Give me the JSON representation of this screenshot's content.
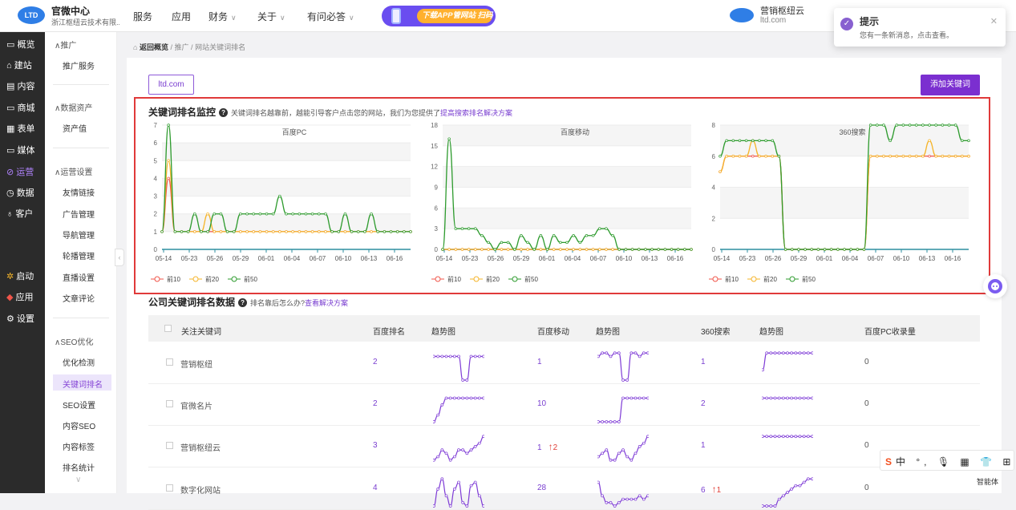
{
  "app": {
    "title": "官微中心",
    "subtitle": "浙江枢纽云技术有限...",
    "logo_text": "LTD"
  },
  "topnav": [
    {
      "label": "服务",
      "has_dropdown": false
    },
    {
      "label": "应用",
      "has_dropdown": false
    },
    {
      "label": "财务",
      "has_dropdown": true
    },
    {
      "label": "关于",
      "has_dropdown": true
    },
    {
      "label": "有问必答",
      "has_dropdown": true
    }
  ],
  "promo": {
    "text": "下载APP管网站 扫码"
  },
  "user": {
    "name": "营销枢纽云",
    "site": "ltd.com"
  },
  "toast": {
    "title": "提示",
    "message": "您有一条新消息，点击查看。"
  },
  "sidebar": [
    {
      "label": "概览",
      "icon": "dashboard-icon"
    },
    {
      "label": "建站",
      "icon": "home-icon"
    },
    {
      "label": "内容",
      "icon": "document-icon"
    },
    {
      "label": "商城",
      "icon": "cart-icon"
    },
    {
      "label": "表单",
      "icon": "form-icon"
    },
    {
      "label": "媒体",
      "icon": "media-icon"
    },
    {
      "label": "运营",
      "icon": "operation-icon",
      "active": true
    },
    {
      "label": "数据",
      "icon": "data-icon"
    },
    {
      "label": "客户",
      "icon": "user-icon"
    },
    {
      "label": "启动",
      "icon": "launch-icon"
    },
    {
      "label": "应用",
      "icon": "apps-icon"
    },
    {
      "label": "设置",
      "icon": "settings-icon"
    }
  ],
  "submenu": {
    "promote": {
      "header": "推广",
      "items": [
        "推广服务"
      ]
    },
    "assets": {
      "header": "数据资产",
      "items": [
        "资产值"
      ]
    },
    "ops": {
      "header": "运营设置",
      "items": [
        "友情链接",
        "广告管理",
        "导航管理",
        "轮播管理",
        "直播设置",
        "文章评论"
      ]
    },
    "seo": {
      "header": "SEO优化",
      "items": [
        "优化检测",
        "关键词排名",
        "SEO设置",
        "内容SEO",
        "内容标签",
        "排名统计"
      ],
      "active": "关键词排名"
    }
  },
  "breadcrumb": {
    "back": "返回概览",
    "sep": "/",
    "level1": "推广",
    "level2": "网站关键词排名"
  },
  "site_button": "ltd.com",
  "add_button": "添加关键词",
  "monitor": {
    "title": "关键词排名监控",
    "desc": "关键词排名越靠前，越能引导客户点击您的网站，我们为您提供了",
    "link": "提高搜索排名解决方案"
  },
  "company": {
    "title": "公司关键词排名数据",
    "desc": "排名靠后怎么办?",
    "link": "查看解决方案"
  },
  "chart_data": [
    {
      "type": "line",
      "title": "百度PC",
      "x": [
        "05-14",
        "05-23",
        "05-26",
        "05-29",
        "06-01",
        "06-04",
        "06-07",
        "06-10",
        "06-13",
        "06-16"
      ],
      "ylim": [
        0,
        7
      ],
      "yticks": [
        0,
        1,
        2,
        3,
        4,
        5,
        6,
        7
      ],
      "series": [
        {
          "name": "前10",
          "color": "#f0554a",
          "values": [
            1,
            4,
            1,
            1,
            1,
            1,
            1,
            1,
            1,
            1,
            1,
            1,
            1,
            1,
            1,
            1,
            1,
            1,
            1,
            1,
            1,
            1,
            1,
            1,
            1,
            1,
            1,
            1,
            1,
            1,
            1,
            1,
            1,
            1,
            1,
            1,
            1,
            1,
            1
          ]
        },
        {
          "name": "前20",
          "color": "#f5b42a",
          "values": [
            1,
            5,
            1,
            1,
            1,
            1,
            1,
            2,
            1,
            1,
            1,
            1,
            1,
            1,
            1,
            1,
            1,
            1,
            1,
            1,
            1,
            1,
            1,
            1,
            1,
            1,
            1,
            1,
            1,
            1,
            1,
            1,
            1,
            1,
            1,
            1,
            1,
            1,
            1
          ]
        },
        {
          "name": "前50",
          "color": "#2e9b2e",
          "values": [
            1,
            7,
            1,
            1,
            1,
            2,
            1,
            1,
            2,
            2,
            1,
            1,
            2,
            2,
            2,
            2,
            2,
            2,
            3,
            2,
            2,
            2,
            2,
            2,
            2,
            2,
            1,
            1,
            2,
            1,
            1,
            1,
            2,
            1,
            1,
            1,
            1,
            1,
            1
          ]
        }
      ]
    },
    {
      "type": "line",
      "title": "百度移动",
      "x": [
        "05-14",
        "05-23",
        "05-26",
        "05-29",
        "06-01",
        "06-04",
        "06-07",
        "06-10",
        "06-13",
        "06-16"
      ],
      "ylim": [
        0,
        18
      ],
      "yticks": [
        0,
        3,
        6,
        9,
        12,
        15,
        18
      ],
      "series": [
        {
          "name": "前10",
          "color": "#f0554a",
          "values": [
            0,
            0,
            0,
            0,
            0,
            0,
            0,
            0,
            0,
            0,
            0,
            0,
            0,
            0,
            0,
            0,
            0,
            0,
            0,
            0,
            0,
            0,
            0,
            0,
            0,
            0,
            0,
            0,
            0,
            0,
            0,
            0,
            0,
            0,
            0,
            0,
            0,
            0,
            0
          ]
        },
        {
          "name": "前20",
          "color": "#f5b42a",
          "values": [
            0,
            0,
            0,
            0,
            0,
            0,
            0,
            0,
            0,
            0,
            0,
            0,
            0,
            0,
            0,
            0,
            0,
            0,
            0,
            0,
            0,
            0,
            0,
            0,
            0,
            0,
            0,
            0,
            0,
            0,
            0,
            0,
            0,
            0,
            0,
            0,
            0,
            0,
            0
          ]
        },
        {
          "name": "前50",
          "color": "#2e9b2e",
          "values": [
            0,
            16,
            3,
            3,
            3,
            3,
            2,
            1,
            0,
            1,
            1,
            0,
            2,
            1,
            0,
            2,
            0,
            2,
            1,
            1,
            2,
            1,
            2,
            2,
            3,
            3,
            2,
            0,
            0,
            0,
            0,
            0,
            0,
            0,
            0,
            0,
            0,
            0,
            0
          ]
        }
      ]
    },
    {
      "type": "line",
      "title": "360搜索",
      "x": [
        "05-14",
        "05-23",
        "05-26",
        "05-29",
        "06-01",
        "06-04",
        "06-07",
        "06-10",
        "06-13",
        "06-16"
      ],
      "ylim": [
        0,
        8
      ],
      "yticks": [
        0,
        2,
        4,
        6,
        8
      ],
      "series": [
        {
          "name": "前10",
          "color": "#f0554a",
          "values": [
            5,
            6,
            6,
            6,
            6,
            6,
            6,
            6,
            6,
            6,
            0,
            0,
            0,
            0,
            0,
            0,
            0,
            0,
            0,
            0,
            0,
            0,
            0,
            6,
            6,
            6,
            6,
            6,
            6,
            6,
            6,
            6,
            6,
            6,
            6,
            6,
            6,
            6,
            6
          ]
        },
        {
          "name": "前20",
          "color": "#f5b42a",
          "values": [
            5,
            6,
            6,
            6,
            6,
            7,
            6,
            6,
            6,
            6,
            0,
            0,
            0,
            0,
            0,
            0,
            0,
            0,
            0,
            0,
            0,
            0,
            0,
            6,
            6,
            6,
            6,
            6,
            6,
            6,
            6,
            6,
            7,
            6,
            6,
            6,
            6,
            6,
            6
          ]
        },
        {
          "name": "前50",
          "color": "#2e9b2e",
          "values": [
            6,
            7,
            7,
            7,
            7,
            7,
            7,
            7,
            7,
            6,
            0,
            0,
            0,
            0,
            0,
            0,
            0,
            0,
            0,
            0,
            0,
            0,
            0,
            8,
            8,
            8,
            7,
            8,
            8,
            8,
            8,
            8,
            8,
            8,
            8,
            8,
            8,
            7,
            7
          ]
        }
      ]
    }
  ],
  "table": {
    "headers": [
      "关注关键词",
      "百度排名",
      "趋势图",
      "百度移动",
      "趋势图",
      "360搜索",
      "趋势图",
      "百度PC收录量"
    ],
    "rows": [
      {
        "keyword": "营销枢纽",
        "baidu": "2",
        "mobile": "1",
        "mobile_up": "",
        "s360": "1",
        "s360_up": "",
        "indexed": "0",
        "tr1": [
          2,
          2,
          2,
          2,
          2,
          2,
          2,
          9,
          9,
          2,
          2,
          2,
          2
        ],
        "tr2": [
          2,
          1,
          1,
          2,
          1,
          1,
          9,
          9,
          1,
          1,
          2,
          1,
          1
        ],
        "tr3": [
          6,
          1,
          1,
          1,
          1,
          1,
          1,
          1,
          1,
          1,
          1,
          1,
          1
        ]
      },
      {
        "keyword": "官微名片",
        "baidu": "2",
        "mobile": "10",
        "mobile_up": "",
        "s360": "2",
        "s360_up": "",
        "indexed": "0",
        "tr1": [
          9,
          7,
          4,
          2,
          2,
          2,
          2,
          2,
          2,
          2,
          2,
          2,
          2
        ],
        "tr2": [
          9,
          9,
          9,
          9,
          9,
          9,
          2,
          2,
          2,
          2,
          2,
          2,
          2
        ],
        "tr3": [
          2,
          2,
          2,
          2,
          2,
          2,
          2,
          2,
          2,
          2,
          2,
          2,
          2
        ]
      },
      {
        "keyword": "营销枢纽云",
        "baidu": "3",
        "mobile": "1",
        "mobile_up": "2",
        "s360": "1",
        "s360_up": "",
        "indexed": "0",
        "tr1": [
          8,
          7,
          5,
          6,
          8,
          7,
          5,
          5,
          6,
          5,
          4,
          3,
          1
        ],
        "tr2": [
          7,
          6,
          5,
          8,
          8,
          6,
          5,
          7,
          8,
          6,
          4,
          3,
          1
        ],
        "tr3": [
          1,
          1,
          1,
          1,
          1,
          1,
          1,
          1,
          1,
          1,
          1,
          1,
          1
        ]
      },
      {
        "keyword": "数字化网站",
        "baidu": "4",
        "mobile": "28",
        "mobile_up": "",
        "s360": "6",
        "s360_up": "1",
        "indexed": "0",
        "tr1": [
          9,
          4,
          1,
          6,
          9,
          4,
          2,
          8,
          9,
          3,
          2,
          6,
          9
        ],
        "tr2": [
          2,
          6,
          8,
          8,
          9,
          8,
          7,
          7,
          7,
          7,
          6,
          7,
          6
        ],
        "tr3": [
          9,
          9,
          9,
          9,
          7,
          6,
          5,
          4,
          3,
          3,
          2,
          1,
          1
        ]
      }
    ]
  },
  "ime": {
    "text": "中 °, 🎙 ▦ 👕 ⊞"
  },
  "agent_label": "智能体"
}
